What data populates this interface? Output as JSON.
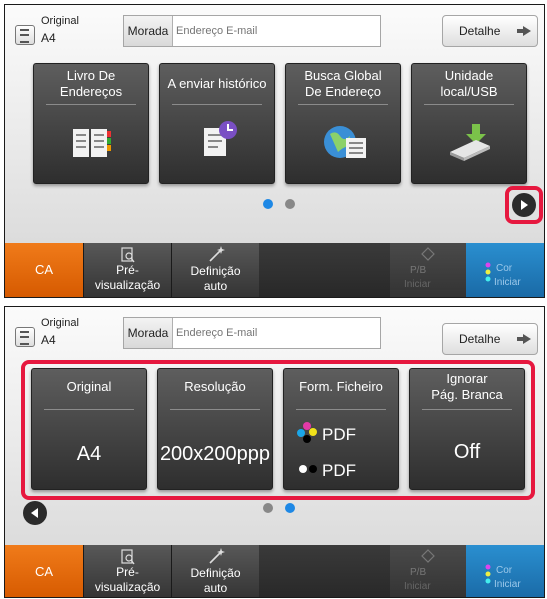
{
  "header": {
    "original_label": "Original",
    "original_value": "A4",
    "address_label": "Morada",
    "address_placeholder": "Endereço E-mail",
    "detail_label": "Detalhe"
  },
  "panel1": {
    "tiles": [
      {
        "line1": "Livro De",
        "line2": "Endereços",
        "icon": "address-book-icon"
      },
      {
        "line1": "A enviar histórico",
        "line2": "",
        "icon": "sending-history-icon"
      },
      {
        "line1": "Busca Global",
        "line2": "De Endereço",
        "icon": "global-search-icon"
      },
      {
        "line1": "Unidade",
        "line2": "local/USB",
        "icon": "usb-drive-icon"
      }
    ]
  },
  "panel2": {
    "tiles": [
      {
        "title": "Original",
        "value": "A4"
      },
      {
        "title": "Resolução",
        "value": "200x200ppp"
      },
      {
        "title": "Form. Ficheiro",
        "value1": "PDF",
        "value2": "PDF"
      },
      {
        "title_line1": "Ignorar",
        "title_line2": "Pág. Branca",
        "value": "Off"
      }
    ]
  },
  "bottom": {
    "ca": "CA",
    "preview_line1": "Pré-",
    "preview_line2": "visualização",
    "auto_line1": "Definição",
    "auto_line2": "auto",
    "bw_line1": "P/B",
    "bw_line2": "Iniciar",
    "color_line1": "Cor",
    "color_line2": "Iniciar"
  },
  "colors": {
    "accent_orange": "#e8700c",
    "highlight_red": "#e6183f",
    "page_dot_blue": "#1e88e5",
    "color_start_blue": "#1da2e3"
  }
}
